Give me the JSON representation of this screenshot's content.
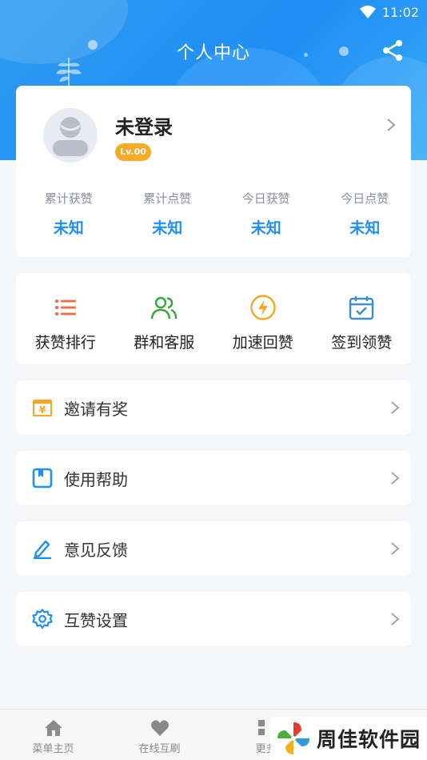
{
  "status_bar": {
    "time": "11:02"
  },
  "header": {
    "title": "个人中心"
  },
  "profile": {
    "username": "未登录",
    "level": "Lv.00",
    "stats": [
      {
        "label": "累计获赞",
        "value": "未知"
      },
      {
        "label": "累计点赞",
        "value": "未知"
      },
      {
        "label": "今日获赞",
        "value": "未知"
      },
      {
        "label": "今日点赞",
        "value": "未知"
      }
    ]
  },
  "actions": [
    {
      "label": "获赞排行",
      "icon": "list-icon",
      "color": "#f0704e"
    },
    {
      "label": "群和客服",
      "icon": "users-icon",
      "color": "#3aa63a"
    },
    {
      "label": "加速回赞",
      "icon": "lightning-icon",
      "color": "#f5a623"
    },
    {
      "label": "签到领赞",
      "icon": "calendar-check-icon",
      "color": "#3b8fd6"
    }
  ],
  "menu": [
    {
      "label": "邀请有奖",
      "icon": "gift-yuan-icon",
      "color": "#f5a623"
    },
    {
      "label": "使用帮助",
      "icon": "book-icon",
      "color": "#1f8ef5"
    },
    {
      "label": "意见反馈",
      "icon": "pencil-icon",
      "color": "#1f8ef5"
    },
    {
      "label": "互赞设置",
      "icon": "gear-icon",
      "color": "#1f8ef5"
    }
  ],
  "bottom_nav": [
    {
      "label": "菜单主页",
      "icon": "home-icon"
    },
    {
      "label": "在线互刷",
      "icon": "heart-icon"
    },
    {
      "label": "更多",
      "icon": "grid-icon"
    }
  ],
  "watermark": {
    "text": "周佳软件园"
  }
}
